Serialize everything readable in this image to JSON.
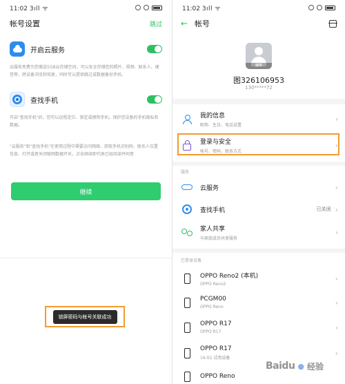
{
  "left": {
    "status": {
      "time": "11:02",
      "signal": "3ıll ᯤ"
    },
    "header": {
      "title": "帐号设置",
      "link": "跳过"
    },
    "cloud_service": {
      "label": "开启云服务",
      "desc": "云服务免费为您赠送5GB云存储空间，可以安全存储您的照片、视频、联系人、便签等，跨设备浏览和恢复，同时可以提供跳过或数据备份手机。"
    },
    "find_phone": {
      "label": "查找手机",
      "desc": "开启\"查找手机\"后，您可以远程定位、锁定或擦除手机，保护您设备的手机隐私和数据。"
    },
    "note": "\"云服务\"和\"查找手机\"在使用过程中需要访问网络、获取手机识别码、联系人位置信息、打开或者关闭联网数据开关，点击继续即代表已经阅读并同意",
    "continue_button": "继续",
    "toast": "锁屏密码与帐号关联成功"
  },
  "right": {
    "header": {
      "title": "帐号"
    },
    "avatar_edit": "编辑",
    "username": "图326106953",
    "phone": "130*****72",
    "items": [
      {
        "label": "我的信息",
        "sub": "昵称、生日、电话设置"
      },
      {
        "label": "登录与安全",
        "sub": "帐号、密码、联系方式"
      },
      {
        "label": "云服务",
        "sub": ""
      },
      {
        "label": "查找手机",
        "sub": "",
        "value": "已关闭"
      },
      {
        "label": "家人共享",
        "sub": "与家庭成员共享服务"
      }
    ],
    "section_service": "服务",
    "section_devices": "已登录设备",
    "devices": [
      {
        "name": "OPPO Reno2 (本机)",
        "model": "OPPO Reno2"
      },
      {
        "name": "PCGM00",
        "model": "OPPO Reno"
      },
      {
        "name": "OPPO R17",
        "model": "OPPO R17"
      },
      {
        "name": "OPPO R17",
        "model": "16:02 试用设备"
      },
      {
        "name": "OPPO Reno",
        "model": ""
      }
    ],
    "watermark": {
      "brand": "Baidu",
      "suffix": "经验"
    }
  },
  "colors": {
    "accent_green": "#2fbf62",
    "accent_blue": "#2d8cf0",
    "highlight_orange": "#f29a2e"
  }
}
